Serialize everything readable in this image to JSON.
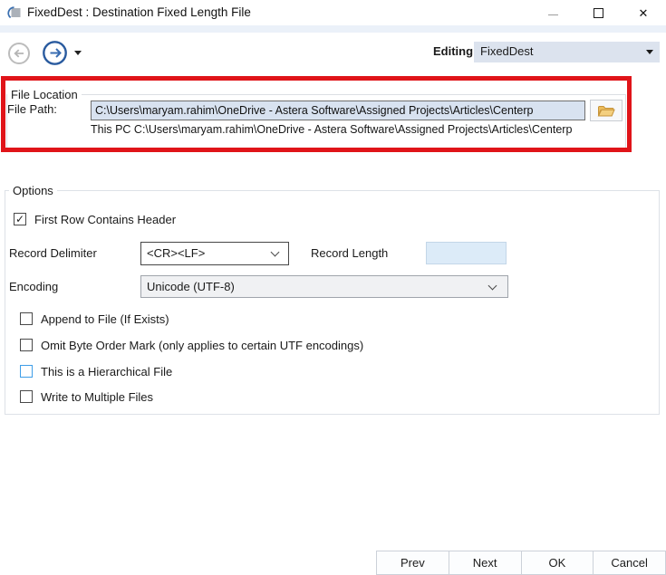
{
  "window": {
    "title": "FixedDest : Destination Fixed Length File"
  },
  "icons": {
    "minimize": "–",
    "close": "✕",
    "check": "✓"
  },
  "toolbar": {
    "editing_label": "Editing:",
    "editing_value": "FixedDest"
  },
  "file_location": {
    "group_label": "File Location",
    "file_path_label": "File Path:",
    "file_path_value": "C:\\Users\\maryam.rahim\\OneDrive - Astera Software\\Assigned Projects\\Articles\\Centerp",
    "resolved_path_text": "This PC C:\\Users\\maryam.rahim\\OneDrive - Astera Software\\Assigned Projects\\Articles\\Centerp"
  },
  "options": {
    "group_label": "Options",
    "first_row_contains_header": {
      "label": "First Row Contains Header",
      "checked": true
    },
    "record_delimiter": {
      "label": "Record Delimiter",
      "value": "<CR><LF>"
    },
    "record_length": {
      "label": "Record Length",
      "value": ""
    },
    "encoding": {
      "label": "Encoding",
      "value": "Unicode (UTF-8)"
    },
    "checkboxes": [
      {
        "label": "Append to File (If Exists)",
        "checked": false
      },
      {
        "label": "Omit Byte Order Mark (only applies to certain UTF encodings)",
        "checked": false
      },
      {
        "label": "This is a Hierarchical File",
        "checked": false
      },
      {
        "label": "Write to Multiple Files",
        "checked": false
      }
    ]
  },
  "footer": {
    "buttons": [
      "Prev",
      "Next",
      "OK",
      "Cancel"
    ]
  },
  "annotation": {
    "highlight_color": "#e01419"
  }
}
